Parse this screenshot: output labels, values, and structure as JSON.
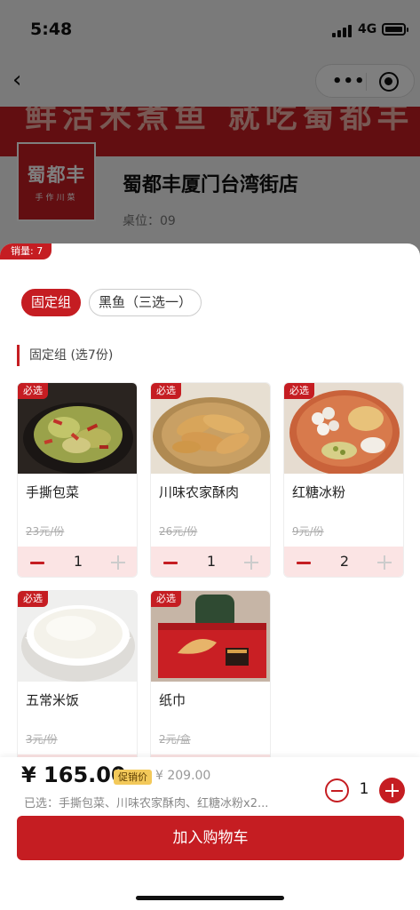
{
  "status_bar": {
    "time": "5:48",
    "network": "4G"
  },
  "banner": {
    "text": "鲜活米煮鱼 就吃蜀都丰"
  },
  "store": {
    "logo_line1": "蜀都丰",
    "logo_line2": "手作川菜",
    "name": "蜀都丰厦门台湾街店",
    "table": "桌位：09"
  },
  "sheet": {
    "sales": "销量: 7",
    "tabs": [
      {
        "label": "固定组",
        "active": true
      },
      {
        "label": "黑鱼（三选一）",
        "active": false
      }
    ],
    "section_title": "固定组 (选7份)",
    "items": [
      {
        "badge": "必选",
        "name": "手撕包菜",
        "price": "23元/份",
        "qty": "1",
        "icon": "stir-fried-cabbage-photo"
      },
      {
        "badge": "必选",
        "name": "川味农家酥肉",
        "price": "26元/份",
        "qty": "1",
        "icon": "crispy-pork-photo"
      },
      {
        "badge": "必选",
        "name": "红糖冰粉",
        "price": "9元/份",
        "qty": "2",
        "icon": "ice-jelly-photo"
      },
      {
        "badge": "必选",
        "name": "五常米饭",
        "price": "3元/份",
        "qty": "",
        "icon": "rice-bowl-photo"
      },
      {
        "badge": "必选",
        "name": "纸巾",
        "price": "2元/盒",
        "qty": "",
        "icon": "tissue-box-photo"
      }
    ]
  },
  "footer": {
    "total": "¥ 165.00",
    "promo_label": "促销价",
    "original_price": "¥ 209.00",
    "selected": "已选：手撕包菜、川味农家酥肉、红糖冰粉x2...",
    "quantity": "1",
    "add_to_cart": "加入购物车"
  },
  "colors": {
    "brand_red": "#c51d22",
    "stepper_bg": "#fbe4e4",
    "promo_yellow": "#f3c95a"
  }
}
